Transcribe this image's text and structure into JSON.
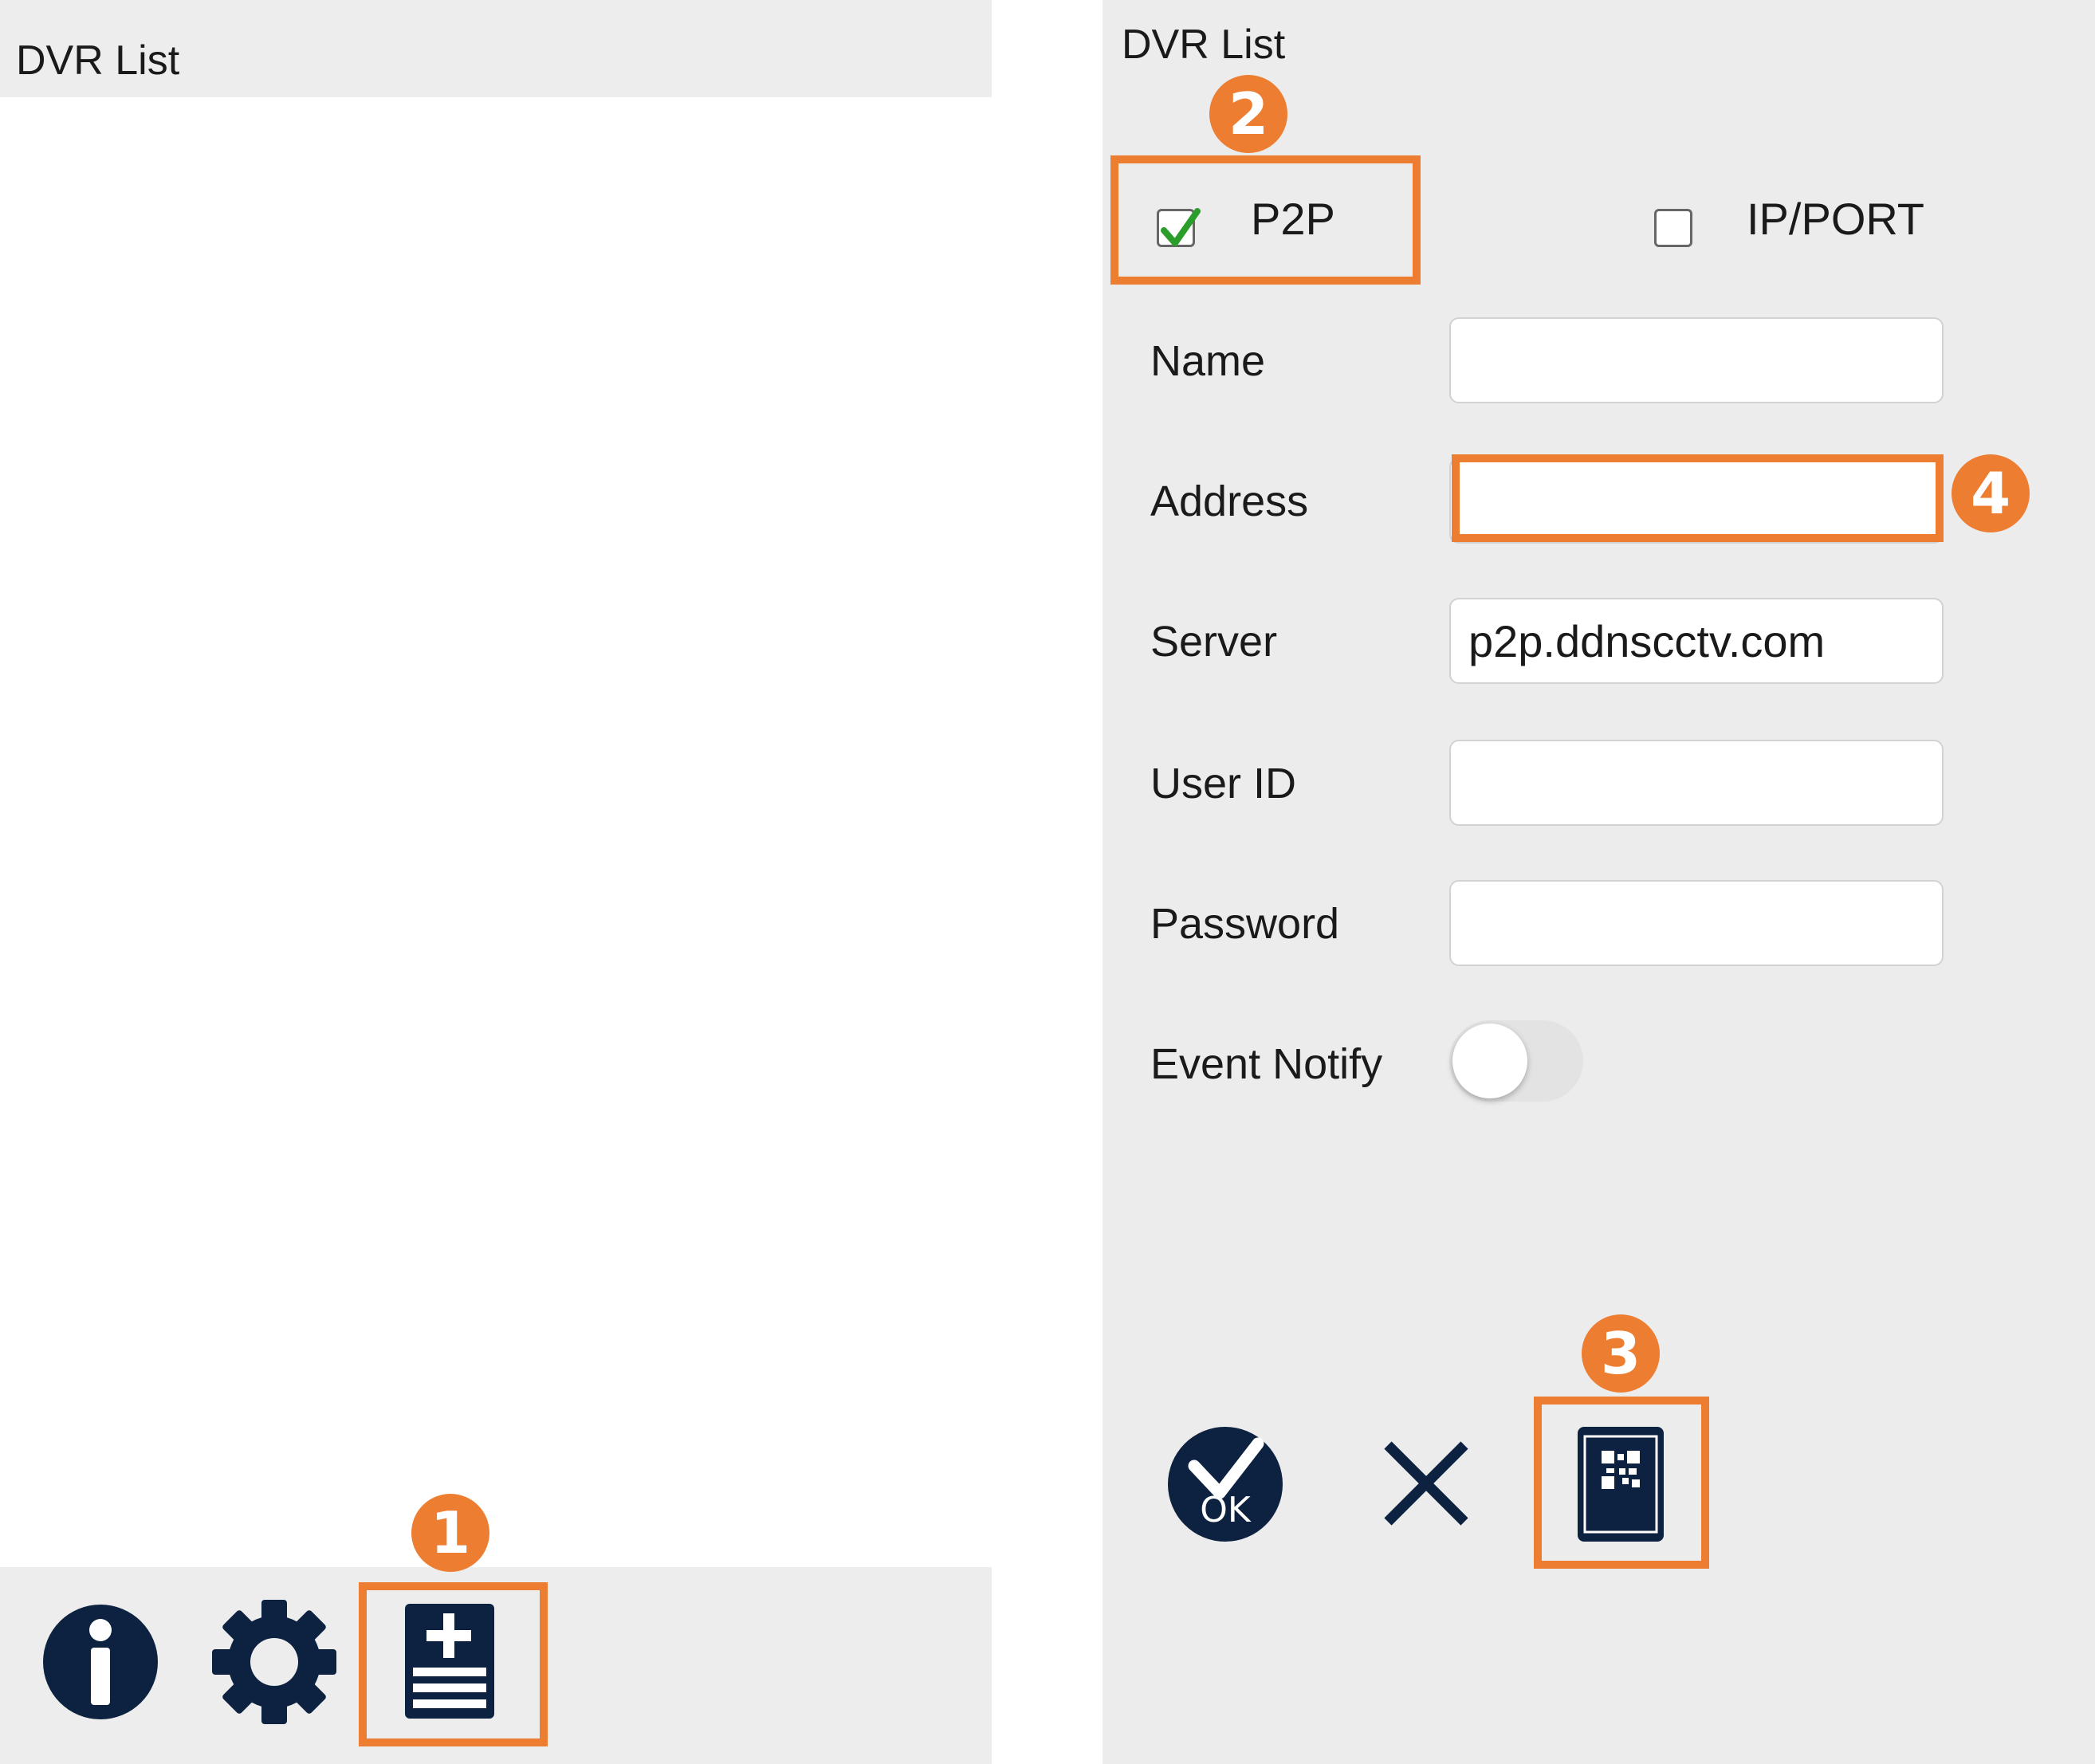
{
  "left": {
    "title": "DVR List",
    "toolbar": {
      "icons": [
        "info-icon",
        "gear-icon",
        "add-device-icon"
      ]
    }
  },
  "right": {
    "title": "DVR List",
    "connection_options": [
      {
        "label": "P2P",
        "checked": true
      },
      {
        "label": "IP/PORT",
        "checked": false
      }
    ],
    "fields": {
      "name": {
        "label": "Name",
        "value": ""
      },
      "address": {
        "label": "Address",
        "value": ""
      },
      "server": {
        "label": "Server",
        "value": "p2p.ddnscctv.com"
      },
      "user_id": {
        "label": "User ID",
        "value": ""
      },
      "password": {
        "label": "Password",
        "value": ""
      }
    },
    "event_notify": {
      "label": "Event Notify",
      "enabled": false
    },
    "actions": {
      "ok_label": "OK",
      "icons": [
        "ok-icon",
        "close-icon",
        "qr-scan-icon"
      ]
    }
  },
  "annotations": {
    "badges": [
      "1",
      "2",
      "3",
      "4"
    ]
  },
  "colors": {
    "accent": "#ec7d31",
    "icon": "#0d2240",
    "panel_bg": "#ececec",
    "check": "#2a9d2a"
  }
}
